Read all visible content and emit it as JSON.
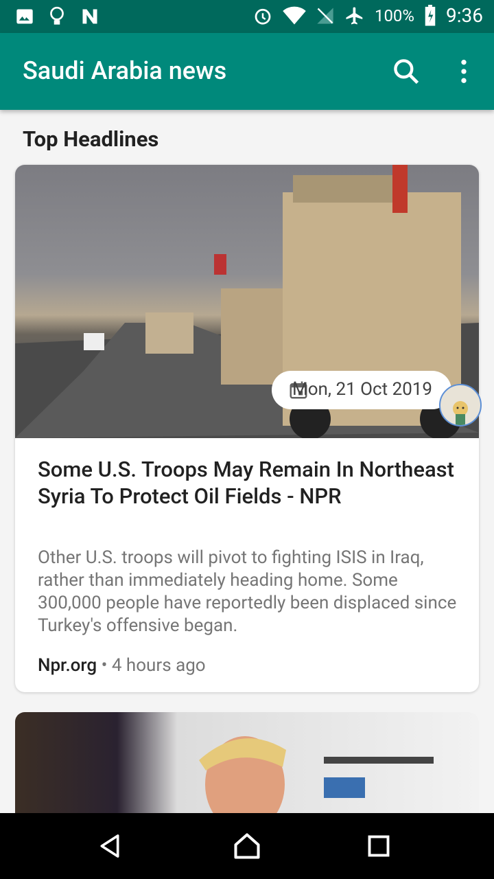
{
  "status_bar": {
    "icons_left": [
      "image-icon",
      "lightbulb-icon",
      "n-logo-icon"
    ],
    "icons_right": [
      "alarm-icon",
      "wifi-icon",
      "no-signal-icon",
      "airplane-icon",
      "battery-icon"
    ],
    "battery": "100%",
    "time": "9:36"
  },
  "app_bar": {
    "title": "Saudi Arabia news",
    "color": "#00897b",
    "status_color": "#00695c"
  },
  "section": {
    "title": "Top Headlines"
  },
  "articles": [
    {
      "date": "Mon, 21 Oct 2019",
      "title": "Some U.S. Troops May Remain In Northeast Syria To Protect Oil Fields - NPR",
      "description": "Other U.S. troops will pivot to fighting ISIS in Iraq, rather than immediately heading home. Some 300,000 people have reportedly been displaced since Turkey's offensive began.",
      "source": "Npr.org",
      "separator": "•",
      "time_ago": "4 hours ago"
    },
    {
      "image": "article-image"
    }
  ],
  "nav": {
    "icons": [
      "back-icon",
      "home-icon",
      "recents-icon"
    ]
  }
}
